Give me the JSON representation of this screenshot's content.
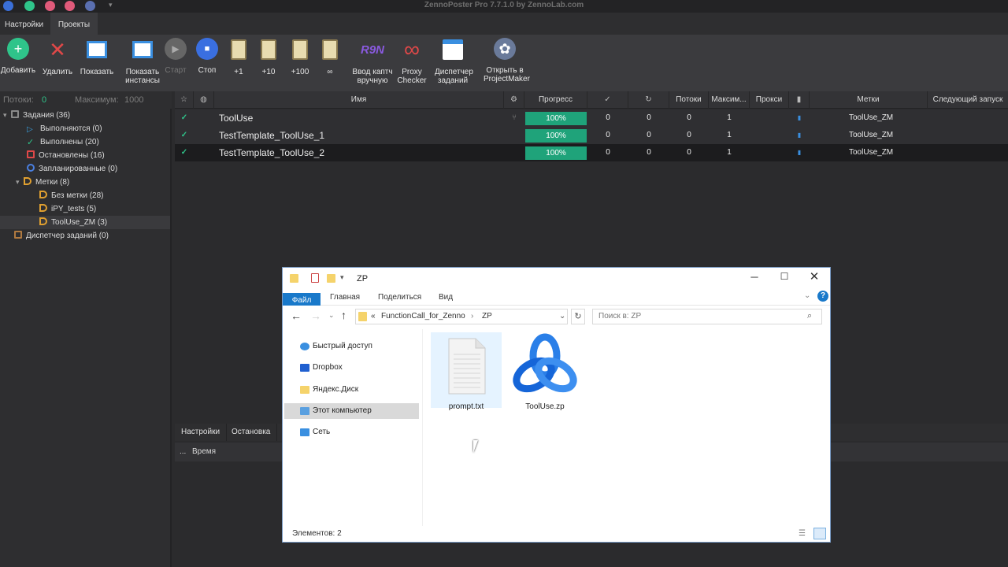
{
  "app": {
    "title": "ZennoPoster Pro 7.7.1.0 by ZennoLab.com"
  },
  "menu": [
    {
      "label": "Настройки"
    },
    {
      "label": "Проекты"
    }
  ],
  "toolbar": [
    {
      "label": "Добавить",
      "icon": "plus-circle-icon"
    },
    {
      "label": "Удалить",
      "icon": "close-icon"
    },
    {
      "label": "Показать",
      "icon": "windows-icon"
    },
    {
      "label": "Показать\nинстансы",
      "icon": "grid-icon"
    },
    {
      "label": "Старт",
      "icon": "play-icon",
      "disabled": true
    },
    {
      "label": "Стоп",
      "icon": "stop-icon"
    },
    {
      "label": "+1",
      "icon": "clipboard-icon"
    },
    {
      "label": "+10",
      "icon": "clipboard-icon"
    },
    {
      "label": "+100",
      "icon": "clipboard-icon"
    },
    {
      "label": "∞",
      "icon": "clipboard-icon"
    },
    {
      "label": "Ввод каптч\nвручную",
      "icon": "captcha-icon"
    },
    {
      "label": "Proxy\nChecker",
      "icon": "infinity-icon"
    },
    {
      "label": "Диспетчер\nзаданий",
      "icon": "calendar-icon"
    },
    {
      "label": "Открыть в\nProjectMaker",
      "icon": "projectmaker-icon"
    }
  ],
  "status": {
    "threads_label": "Потоки:",
    "threads_value": "0",
    "max_label": "Максимум:",
    "max_value": "1000"
  },
  "tree": [
    {
      "label": "Задания (36)",
      "level": 0,
      "color": "#8a8a8a",
      "shape": "clip"
    },
    {
      "label": "Выполняются (0)",
      "level": 1,
      "color": "#3aa0e0",
      "shape": "play"
    },
    {
      "label": "Выполнены (20)",
      "level": 1,
      "color": "#2fc48a",
      "shape": "check"
    },
    {
      "label": "Остановлены (16)",
      "level": 1,
      "color": "#e04848",
      "shape": "square"
    },
    {
      "label": "Запланированные (0)",
      "level": 1,
      "color": "#4a7fe0",
      "shape": "clock"
    },
    {
      "label": "Метки (8)",
      "level": 1,
      "color": "#e0a030",
      "shape": "tag"
    },
    {
      "label": "Без метки (28)",
      "level": 2,
      "color": "#e0a030",
      "shape": "tag"
    },
    {
      "label": "iPY_tests (5)",
      "level": 2,
      "color": "#e0a030",
      "shape": "tag"
    },
    {
      "label": "ToolUse_ZM (3)",
      "level": 2,
      "color": "#e0a030",
      "shape": "tag",
      "selected": true
    },
    {
      "label": "Диспетчер заданий (0)",
      "level": 0,
      "color": "#b07a40",
      "shape": "cal"
    }
  ],
  "columns": {
    "name": "Имя",
    "progress": "Прогресс",
    "threads": "Потоки",
    "max": "Максим...",
    "proxy": "Прокси",
    "tags": "Метки",
    "next": "Следующий запуск"
  },
  "rows": [
    {
      "name": "ToolUse",
      "progress": "100%",
      "progress_value": 100,
      "success": "0",
      "retries": "0",
      "threads": "0",
      "max": "1",
      "tags": "ToolUse_ZM",
      "has_graph": true
    },
    {
      "name": "TestTemplate_ToolUse_1",
      "progress": "100%",
      "progress_value": 100,
      "success": "0",
      "retries": "0",
      "threads": "0",
      "max": "1",
      "tags": "ToolUse_ZM",
      "has_graph": false
    },
    {
      "name": "TestTemplate_ToolUse_2",
      "progress": "100%",
      "progress_value": 100,
      "success": "0",
      "retries": "0",
      "threads": "0",
      "max": "1",
      "tags": "ToolUse_ZM",
      "has_graph": false,
      "selected": true
    }
  ],
  "lower_tabs": [
    {
      "label": "Настройки"
    },
    {
      "label": "Остановка"
    }
  ],
  "lower_head": {
    "ellipsis": "...",
    "time": "Время"
  },
  "explorer": {
    "title": "ZP",
    "ribbon": [
      {
        "label": "Файл"
      },
      {
        "label": "Главная"
      },
      {
        "label": "Поделиться"
      },
      {
        "label": "Вид"
      }
    ],
    "address": {
      "prefix": "«",
      "seg1": "FunctionCall_for_Zenno",
      "sep": "›",
      "seg2": "ZP"
    },
    "search_placeholder": "Поиск в: ZP",
    "nav": [
      {
        "label": "Быстрый доступ",
        "icon": "star-icon"
      },
      {
        "label": "Dropbox",
        "icon": "dropbox-icon"
      },
      {
        "label": "Яндекс.Диск",
        "icon": "folder-icon"
      },
      {
        "label": "Этот компьютер",
        "icon": "computer-icon",
        "selected": true
      },
      {
        "label": "Сеть",
        "icon": "network-icon"
      }
    ],
    "files": [
      {
        "name": "prompt.txt",
        "icon": "text-file-icon",
        "selected": true
      },
      {
        "name": "ToolUse.zp",
        "icon": "zennoposter-file-icon"
      }
    ],
    "status": "Элементов: 2"
  }
}
